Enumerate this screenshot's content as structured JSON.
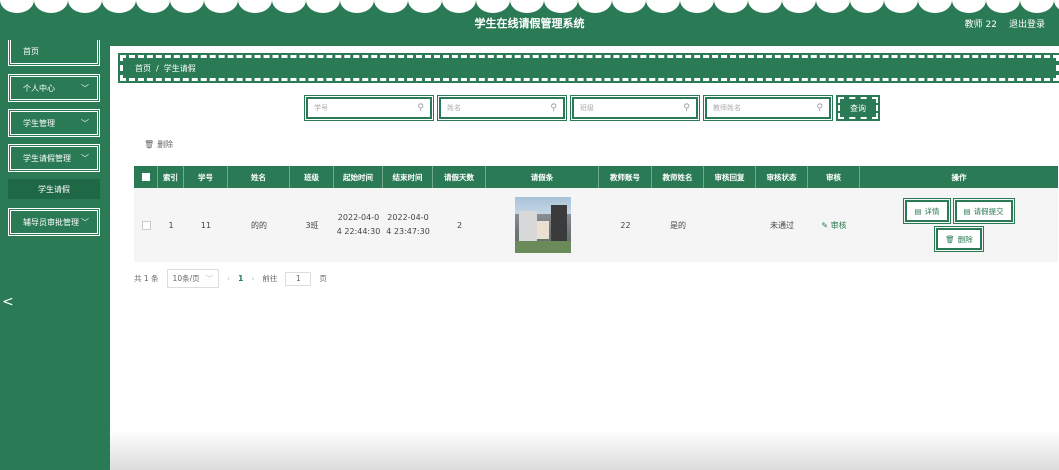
{
  "header": {
    "app_title": "学生在线请假管理系统",
    "user_label": "教师 22",
    "logout_label": "退出登录"
  },
  "sidebar": {
    "items": [
      {
        "label": "首页",
        "has_children": false
      },
      {
        "label": "个人中心",
        "has_children": true
      },
      {
        "label": "学生管理",
        "has_children": true
      },
      {
        "label": "学生请假管理",
        "has_children": true,
        "expanded": true
      },
      {
        "label": "辅导员审批管理",
        "has_children": true
      }
    ],
    "sub_item": "学生请假",
    "chevron": "﹀",
    "collapse_glyph": "<"
  },
  "breadcrumb": {
    "home": "首页",
    "separator": "/",
    "current": "学生请假"
  },
  "search": {
    "fields": [
      {
        "placeholder": "学号"
      },
      {
        "placeholder": "姓名"
      },
      {
        "placeholder": "班级"
      },
      {
        "placeholder": "教师姓名"
      }
    ],
    "query_label": "查询"
  },
  "toolbar": {
    "delete_label": "删除"
  },
  "table": {
    "columns": [
      "索引",
      "学号",
      "姓名",
      "班级",
      "起始时间",
      "结束时间",
      "请假天数",
      "请假条",
      "教师账号",
      "教师姓名",
      "审核回复",
      "审核状态",
      "审核",
      "操作"
    ],
    "rows": [
      {
        "index": "1",
        "student_no": "11",
        "name": "的的",
        "class": "3班",
        "start_time_l1": "2022-04-0",
        "start_time_l2": "4 22:44:30",
        "end_time_l1": "2022-04-0",
        "end_time_l2": "4 23:47:30",
        "days": "2",
        "teacher_account": "22",
        "teacher_name": "是的",
        "audit_reply": "",
        "audit_status": "未通过",
        "audit_link": "审核",
        "actions": {
          "detail": "详情",
          "submit": "请假提交",
          "delete": "删除"
        }
      }
    ]
  },
  "pagination": {
    "total": "共 1 条",
    "page_size": "10条/页",
    "current_page": "1",
    "goto_label": "前往",
    "goto_value": "1",
    "page_suffix": "页"
  },
  "colors": {
    "primary": "#2a7a55",
    "background": "#ffffff"
  }
}
